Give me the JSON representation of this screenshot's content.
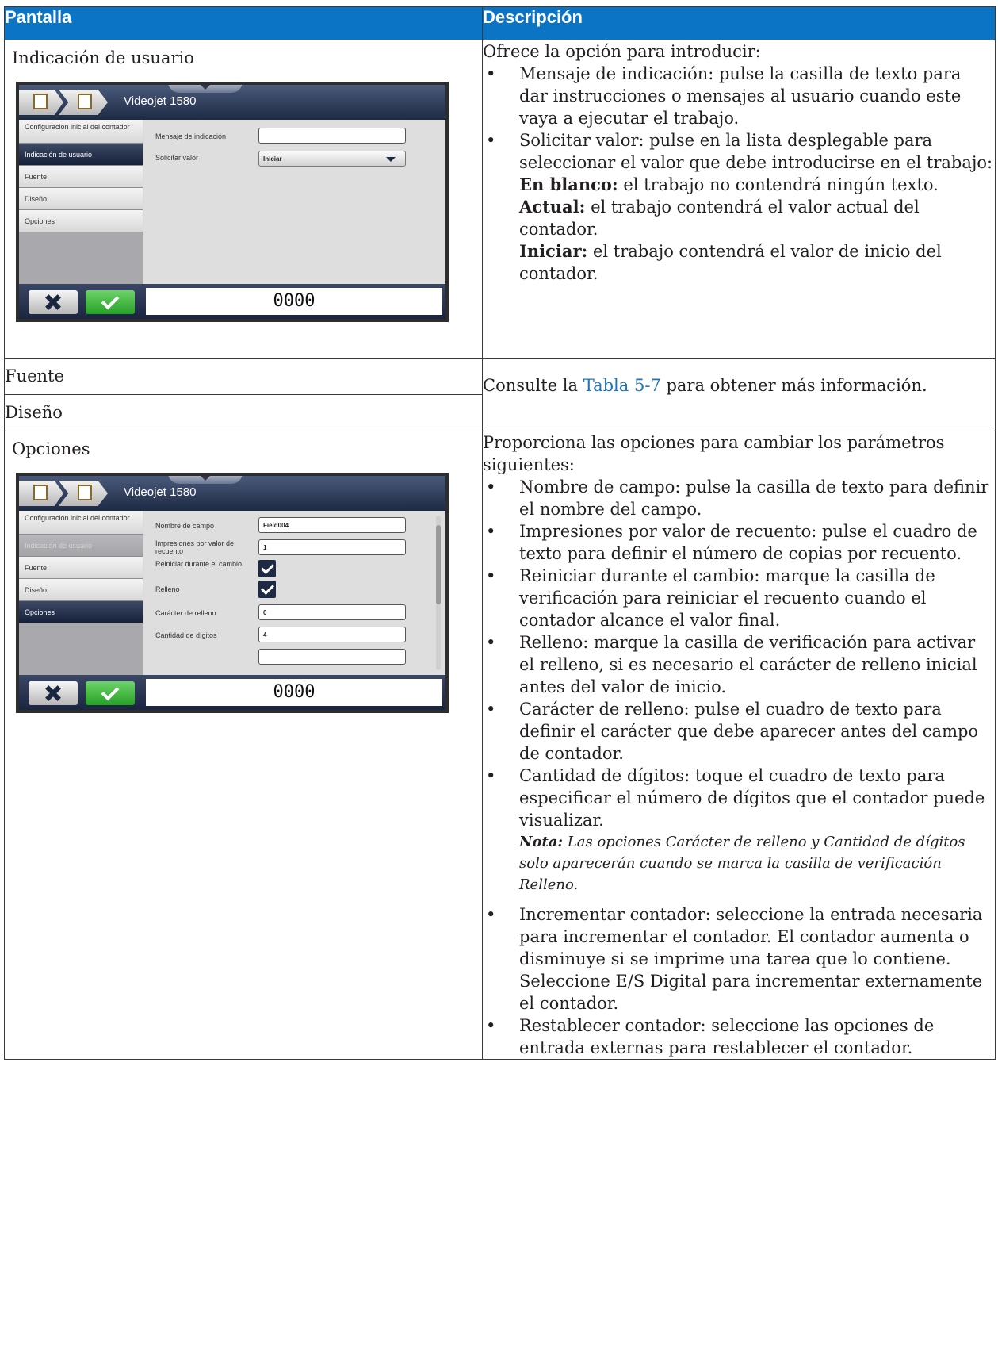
{
  "table": {
    "headers": [
      "Pantalla",
      "Descripción"
    ]
  },
  "row1": {
    "title": "Indicación de usuario",
    "device": {
      "title": "Videojet 1580",
      "sidebar": [
        "Configuración inicial del contador",
        "Indicación de usuario",
        "Fuente",
        "Diseño",
        "Opciones"
      ],
      "fields": {
        "prompt_label": "Mensaje de indicación",
        "prompt_value": "",
        "request_label": "Solicitar valor",
        "request_value": "Iniciar"
      },
      "counter": "0000"
    },
    "desc": {
      "intro": "Ofrece la opción para introducir:",
      "b1": "Mensaje de indicación: pulse la casilla de texto para dar instrucciones o mensajes al usuario cuando este vaya a ejecutar el trabajo.",
      "b2": "Solicitar valor: pulse en la lista desplegable para seleccionar el valor que debe introducirse en el trabajo:",
      "opt1_b": "En blanco:",
      "opt1": " el trabajo no contendrá ningún texto.",
      "opt2_b": "Actual:",
      "opt2": " el trabajo contendrá el valor actual del contador.",
      "opt3_b": "Iniciar:",
      "opt3": " el trabajo contendrá el valor de inicio del contador."
    }
  },
  "row2": {
    "title_a": "Fuente",
    "title_b": "Diseño",
    "desc_pre": "Consulte la ",
    "desc_link": "Tabla 5-7",
    "desc_post": " para obtener más información."
  },
  "row3": {
    "title": "Opciones",
    "device": {
      "title": "Videojet 1580",
      "sidebar": [
        "Configuración inicial del contador",
        "Indicación de usuario",
        "Fuente",
        "Diseño",
        "Opciones"
      ],
      "fields": {
        "name_label": "Nombre de campo",
        "name_value": "Field004",
        "prints_label": "Impresiones por valor de recuento",
        "prints_value": "1",
        "reset_label": "Reiniciar durante el cambio",
        "fill_label": "Relleno",
        "fillchar_label": "Carácter de relleno",
        "fillchar_value": "0",
        "digits_label": "Cantidad de dígitos",
        "digits_value": "4"
      },
      "counter": "0000"
    },
    "desc": {
      "intro": "Proporciona las opciones para cambiar los parámetros siguientes:",
      "b1": "Nombre de campo: pulse la casilla de texto para definir el nombre del campo.",
      "b2": "Impresiones por valor de recuento: pulse el cuadro de texto para definir el número de copias por recuento.",
      "b3": "Reiniciar durante el cambio: marque la casilla de verificación para reiniciar el recuento cuando el contador alcance el valor final.",
      "b4": "Relleno: marque la casilla de verificación para activar el relleno, si es necesario el carácter de relleno inicial antes del valor de inicio.",
      "b5": "Carácter de relleno: pulse el cuadro de texto para definir el carácter que debe aparecer antes del campo de contador.",
      "b6": "Cantidad de dígitos: toque el cuadro de texto para especificar el número de dígitos que el contador puede visualizar.",
      "note_b": "Nota:",
      "note": " Las opciones Carácter de relleno y Cantidad de dígitos solo aparecerán cuando se marca la casilla de verificación Relleno.",
      "b7": "Incrementar contador: seleccione la entrada necesaria para incrementar el contador. El contador aumenta o disminuye si se imprime una tarea que lo contiene. Seleccione E/S Digital para incrementar externamente el contador.",
      "b8": "Restablecer contador: seleccione las opciones de entrada externas para restablecer el contador."
    }
  }
}
